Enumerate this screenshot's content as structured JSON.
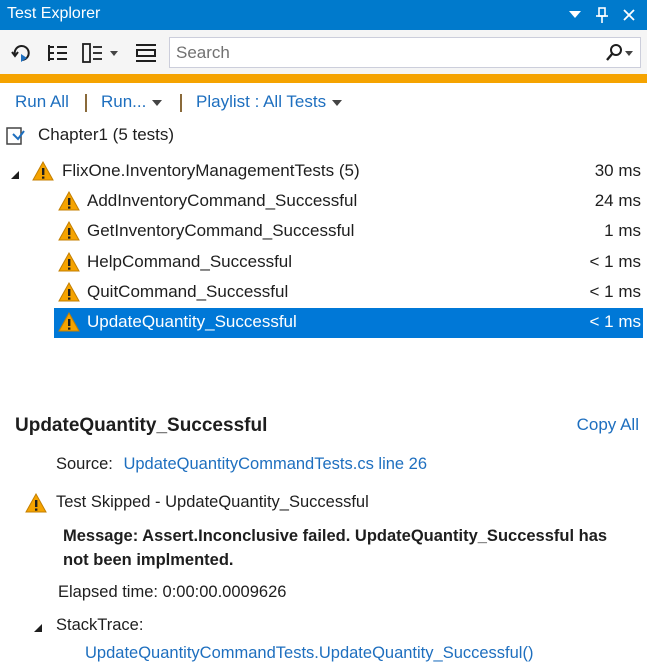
{
  "window": {
    "title": "Test Explorer"
  },
  "titlebar_icons": [
    "dropdown-icon",
    "pin-icon",
    "close-icon"
  ],
  "toolbar": {
    "icons": [
      "run-refresh-icon",
      "group-by-icon",
      "playlist-icon",
      "expand-collapse-icon"
    ],
    "search_placeholder": "Search"
  },
  "commands": {
    "run_all": "Run All",
    "run": "Run...",
    "playlist": "Playlist : All Tests"
  },
  "tree": {
    "project": "Chapter1 (5 tests)",
    "group": {
      "name": "FlixOne.InventoryManagementTests (5)",
      "duration": "30 ms"
    },
    "tests": [
      {
        "name": "AddInventoryCommand_Successful",
        "duration": "24 ms"
      },
      {
        "name": "GetInventoryCommand_Successful",
        "duration": "1 ms"
      },
      {
        "name": "HelpCommand_Successful",
        "duration": "< 1 ms"
      },
      {
        "name": "QuitCommand_Successful",
        "duration": "< 1 ms"
      },
      {
        "name": "UpdateQuantity_Successful",
        "duration": "< 1 ms",
        "selected": true
      }
    ]
  },
  "details": {
    "title": "UpdateQuantity_Successful",
    "copy_all": "Copy All",
    "source_label": "Source:",
    "source_link": "UpdateQuantityCommandTests.cs line 26",
    "status": "Test Skipped - UpdateQuantity_Successful",
    "message": "Message: Assert.Inconclusive failed. UpdateQuantity_Successful has not been implmented.",
    "elapsed": "Elapsed time: 0:00:00.0009626",
    "stacktrace_label": "StackTrace:",
    "stacktrace_link": "UpdateQuantityCommandTests.UpdateQuantity_Successful()"
  },
  "colors": {
    "accent": "#007acc",
    "warning": "#f5a300",
    "selection": "#0078d7",
    "link": "#1e6fbf"
  }
}
